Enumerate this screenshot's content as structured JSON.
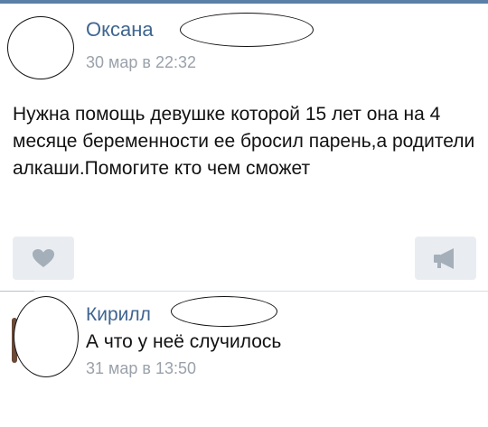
{
  "post": {
    "author": "Оксана",
    "timestamp": "30 мар в 22:32",
    "text": "Нужна помощь девушке которой 15 лет она на 4 месяце беременности ее бросил парень,а родители алкаши.Помогите кто чем сможет"
  },
  "comment": {
    "author": "Кирилл",
    "text": "А что у неё случилось",
    "timestamp": "31 мар в 13:50"
  },
  "icons": {
    "like": "heart-icon",
    "share": "megaphone-icon"
  },
  "colors": {
    "author_name": "#3f6590",
    "timestamp": "#9aa1aa",
    "button_bg": "#e9edf1",
    "icon": "#a4afba",
    "top_bar": "#5b7fa6"
  }
}
